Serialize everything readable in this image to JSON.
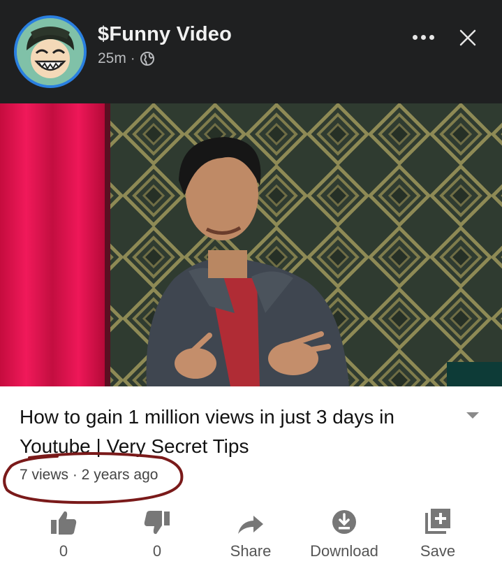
{
  "post": {
    "page_name": "$Funny Video",
    "time": "25m",
    "separator": "·",
    "privacy_icon": "globe-icon",
    "more_icon": "more-dots-icon",
    "close_icon": "close-icon"
  },
  "video": {
    "title": "How to gain 1 million views in just 3 days in Youtube | Very Secret Tips",
    "stats": "7 views · 2 years ago",
    "annotation_color": "#7a1a1a"
  },
  "actions": [
    {
      "icon": "thumbs-up-icon",
      "label": "0"
    },
    {
      "icon": "thumbs-down-icon",
      "label": "0"
    },
    {
      "icon": "share-icon",
      "label": "Share"
    },
    {
      "icon": "download-icon",
      "label": "Download"
    },
    {
      "icon": "save-playlist-icon",
      "label": "Save"
    }
  ],
  "colors": {
    "header_bg": "#1f2021",
    "avatar_ring": "#2a7fe0",
    "curtain": "#e0104f"
  }
}
